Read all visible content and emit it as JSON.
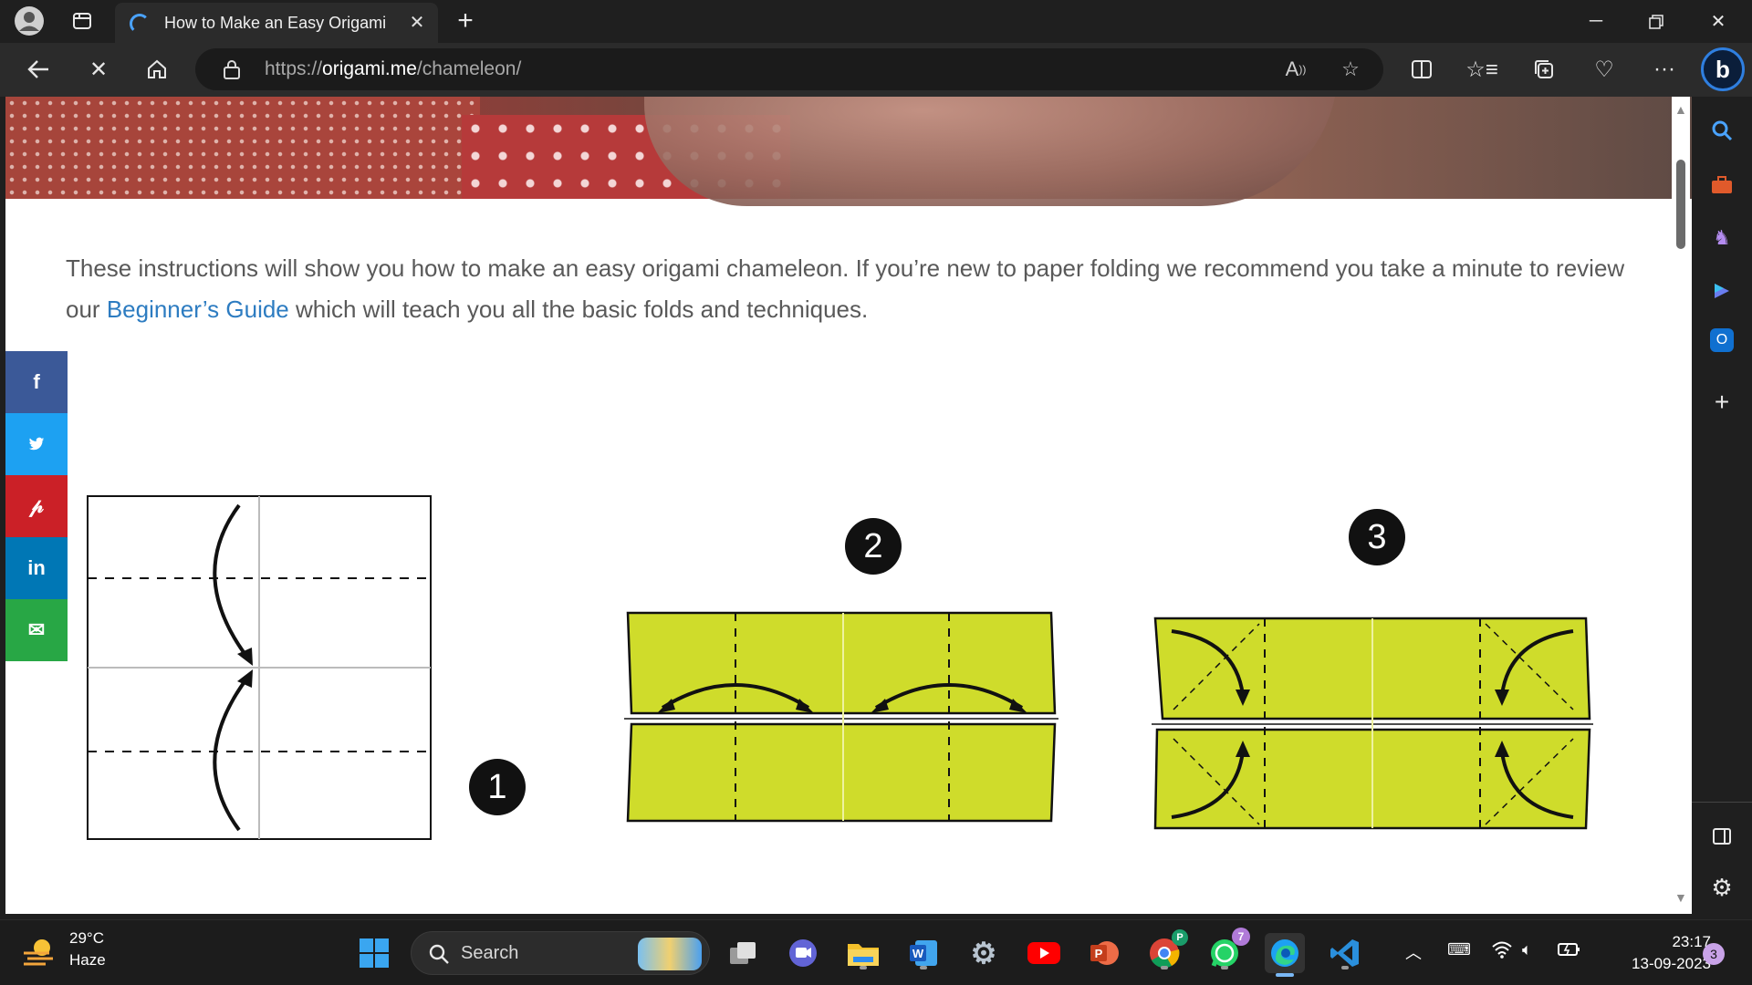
{
  "browser": {
    "tab_title": "How to Make an Easy Origami Cl",
    "url_scheme": "https://",
    "url_host": "origami.me",
    "url_path": "/chameleon/"
  },
  "page": {
    "intro_text_1": "These instructions will show you how to make an easy origami chameleon. If you’re new to paper folding we recommend you take a minute to review our ",
    "intro_link": "Beginner’s Guide",
    "intro_text_2": " which will teach you all the basic folds and techniques.",
    "share": [
      {
        "icon": "facebook-icon",
        "glyph": "f",
        "color": "#3b5998"
      },
      {
        "icon": "twitter-icon",
        "glyph": "🐦",
        "color": "#1da1f2"
      },
      {
        "icon": "pinterest-icon",
        "glyph": "P",
        "color": "#cb2027"
      },
      {
        "icon": "linkedin-icon",
        "glyph": "in",
        "color": "#0077b5"
      },
      {
        "icon": "email-icon",
        "glyph": "✉",
        "color": "#28a745"
      }
    ],
    "steps": [
      "1",
      "2",
      "3"
    ],
    "paper_color": "#cfdc2b"
  },
  "taskbar": {
    "weather_temp": "29°C",
    "weather_desc": "Haze",
    "search_label": "Search",
    "time": "23:17",
    "date": "13-09-2023",
    "notification_count": "3",
    "whatsapp_badge": "7",
    "chrome_profile_badge": "P"
  }
}
